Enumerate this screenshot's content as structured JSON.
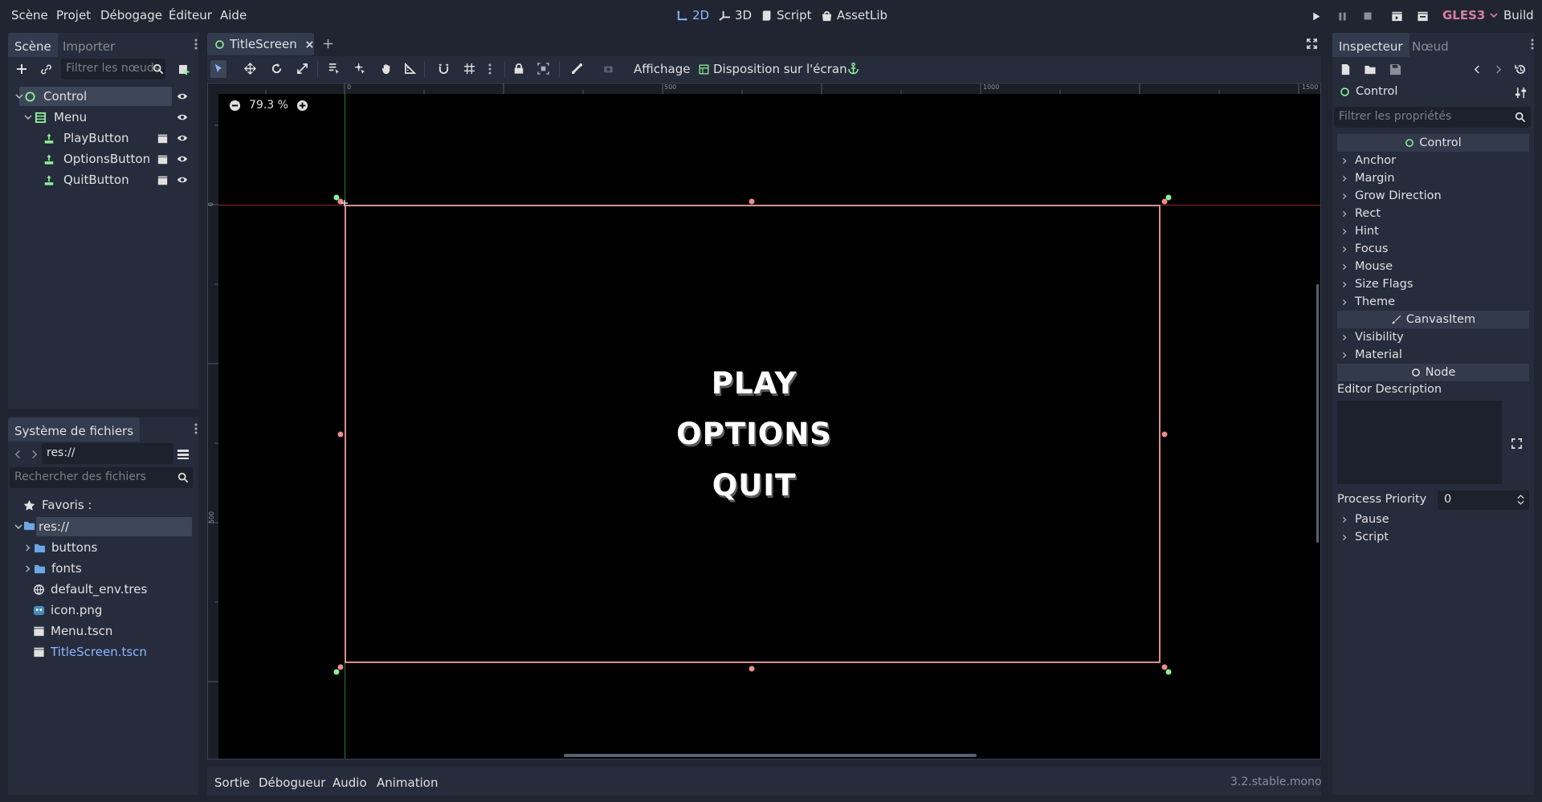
{
  "menu": {
    "items": [
      "Scène",
      "Projet",
      "Débogage",
      "Éditeur",
      "Aide"
    ]
  },
  "workspaces": {
    "two_d": "2D",
    "three_d": "3D",
    "script": "Script",
    "assetlib": "AssetLib"
  },
  "renderer": {
    "label": "GLES3",
    "build": "Build"
  },
  "scene_dock": {
    "tab_scene": "Scène",
    "tab_import": "Importer",
    "filter_placeholder": "Filtrer les nœuds",
    "nodes": [
      {
        "name": "Control",
        "icon": "control-node-icon"
      },
      {
        "name": "Menu",
        "icon": "vbox-container-icon"
      },
      {
        "name": "PlayButton",
        "icon": "texture-button-icon"
      },
      {
        "name": "OptionsButton",
        "icon": "texture-button-icon"
      },
      {
        "name": "QuitButton",
        "icon": "texture-button-icon"
      }
    ]
  },
  "filesystem_dock": {
    "title": "Système de fichiers",
    "path": "res://",
    "search_placeholder": "Rechercher des fichiers",
    "favorites": "Favoris :",
    "root": "res://",
    "entries": [
      {
        "name": "buttons",
        "type": "folder"
      },
      {
        "name": "fonts",
        "type": "folder"
      },
      {
        "name": "default_env.tres",
        "type": "environment"
      },
      {
        "name": "icon.png",
        "type": "image"
      },
      {
        "name": "Menu.tscn",
        "type": "scene"
      },
      {
        "name": "TitleScreen.tscn",
        "type": "scene",
        "highlight": true
      }
    ]
  },
  "editor": {
    "scene_tab": "TitleScreen",
    "zoom": "79.3 %",
    "toolbar_view": "Affichage",
    "toolbar_layout": "Disposition sur l'écran",
    "ruler_labels": [
      "0",
      "500",
      "1000",
      "1500"
    ],
    "ruler_v_labels": [
      "0",
      "500"
    ]
  },
  "game_menu": {
    "play": "PLAY",
    "options": "OPTIONS",
    "quit": "QUIT"
  },
  "inspector": {
    "tab_inspector": "Inspecteur",
    "tab_node": "Nœud",
    "object": "Control",
    "filter_placeholder": "Filtrer les propriétés",
    "cat_control": "Control",
    "control_props": [
      "Anchor",
      "Margin",
      "Grow Direction",
      "Rect",
      "Hint",
      "Focus",
      "Mouse",
      "Size Flags",
      "Theme"
    ],
    "cat_canvasitem": "CanvasItem",
    "canvas_props": [
      "Visibility",
      "Material"
    ],
    "cat_node": "Node",
    "editor_description": "Editor Description",
    "process_priority_label": "Process Priority",
    "process_priority_value": "0",
    "node_props": [
      "Pause",
      "Script"
    ]
  },
  "bottom_panel": {
    "tabs": [
      "Sortie",
      "Débogueur",
      "Audio",
      "Animation"
    ],
    "version": "3.2.stable.mono"
  },
  "colors": {
    "accent": "#8eb6ff",
    "node_green": "#8eef97",
    "gles_pink": "#d67f9f",
    "selection_rect": "#d88f8f"
  }
}
